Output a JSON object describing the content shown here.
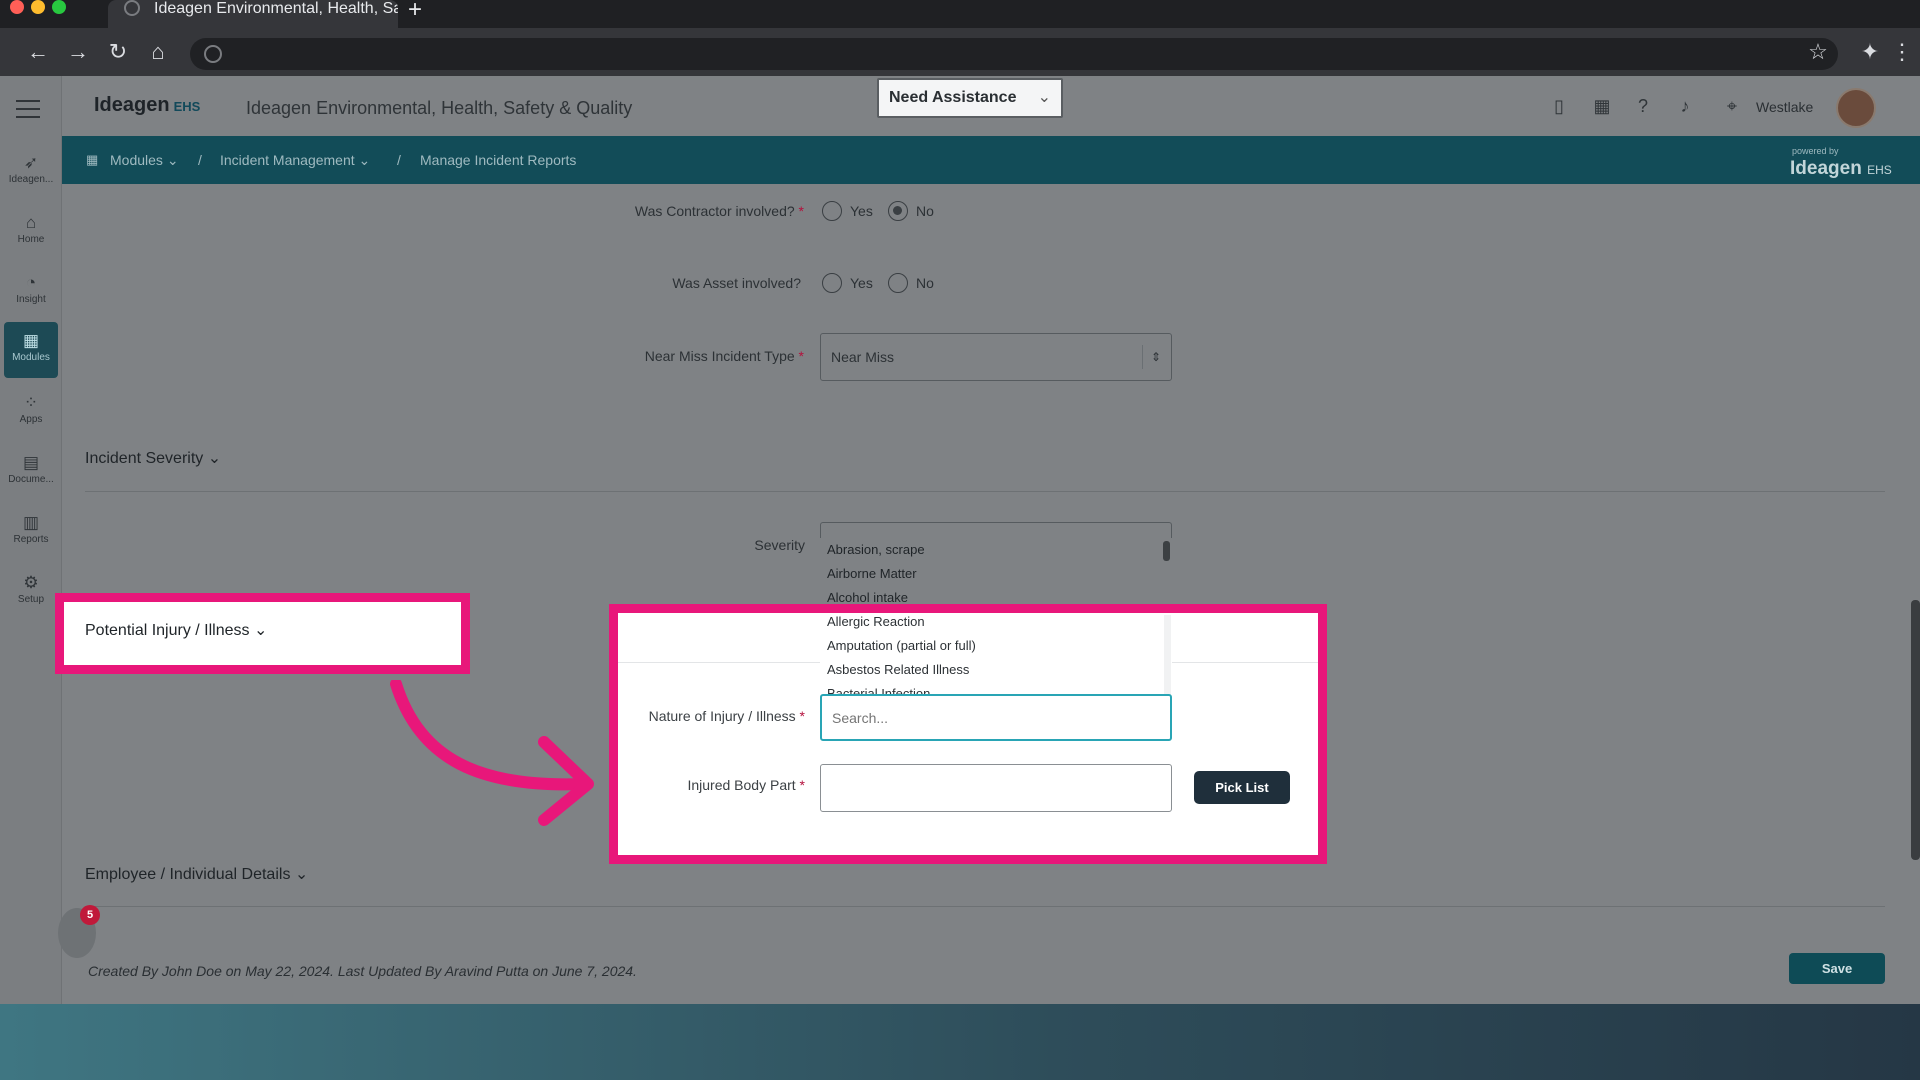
{
  "browser": {
    "tab_title": "Ideagen Environmental, Health, Sa",
    "new_tab": "+",
    "icons": [
      "back-icon",
      "forward-icon",
      "reload-icon",
      "home-icon",
      "globe-icon",
      "star-icon",
      "extensions-icon",
      "menu-dots-icon"
    ]
  },
  "header": {
    "logo_text": "Ideagen",
    "logo_sub": "EHS",
    "app_title": "Ideagen Environmental, Health, Safety & Quality",
    "assist_label": "Need Assistance",
    "location": "Westlake"
  },
  "rail": {
    "items": [
      {
        "label": "Ideagen...",
        "icon": "ideagen-icon"
      },
      {
        "label": "Home",
        "icon": "home-icon"
      },
      {
        "label": "Insight",
        "icon": "insight-icon"
      },
      {
        "label": "Modules",
        "icon": "modules-icon"
      },
      {
        "label": "Apps",
        "icon": "apps-icon"
      },
      {
        "label": "Docume...",
        "icon": "document-icon"
      },
      {
        "label": "Reports",
        "icon": "reports-icon"
      },
      {
        "label": "Setup",
        "icon": "gear-icon"
      }
    ]
  },
  "breadcrumb": {
    "items": [
      "Modules",
      "Incident Management",
      "Manage Incident Reports"
    ],
    "sep": "/",
    "powered_by": "powered by",
    "powered_logo": "Ideagen",
    "powered_sub": "EHS"
  },
  "form": {
    "contractor_label": "Was Contractor involved?",
    "asset_label": "Was Asset involved?",
    "yes": "Yes",
    "no": "No",
    "contractor_value": "No",
    "near_miss_label": "Near Miss Incident Type",
    "near_miss_value": "Near Miss",
    "severity_section": "Incident Severity",
    "severity_label": "Severity",
    "injury_section": "Potential Injury / Illness",
    "nature_label": "Nature of Injury / Illness",
    "search_placeholder": "Search...",
    "body_part_label": "Injured Body Part",
    "pick_list": "Pick List",
    "employee_section": "Employee / Individual Details",
    "req": "*",
    "dropdown_options": [
      "Abrasion, scrape",
      "Airborne Matter",
      "Alcohol intake",
      "Allergic Reaction",
      "Amputation (partial or full)",
      "Asbestos Related Illness",
      "Bacterial Infection"
    ]
  },
  "footer": {
    "created_text": "Created By John Doe on May 22, 2024. Last Updated By Aravind Putta on June 7, 2024.",
    "save": "Save",
    "badge_count": "5"
  },
  "colors": {
    "highlight": "#e8177a",
    "teal": "#124c58",
    "search_border": "#29a5b5"
  }
}
